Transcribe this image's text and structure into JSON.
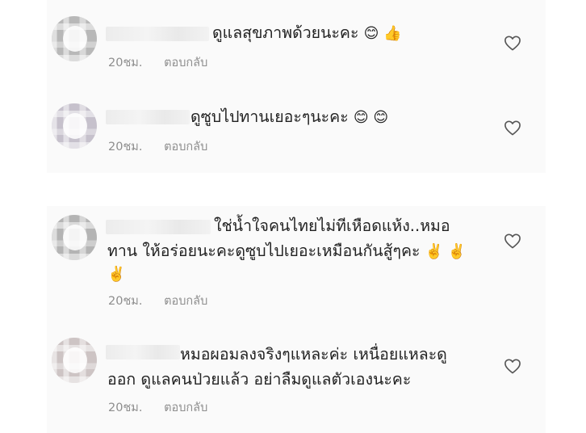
{
  "comments": [
    {
      "text_line1": "ดูแลสุขภาพด้วยนะคะ",
      "emojis": "😊 👍",
      "time": "20ชม.",
      "reply": "ตอบกลับ"
    },
    {
      "text_line1": "ดูซูบไปทานเยอะๆนะคะ",
      "emojis": "😊 😊",
      "time": "20ชม.",
      "reply": "ตอบกลับ"
    },
    {
      "text_line1": "ใช่น้ำใจคนไทยไม่ทีเหือดแห้ง..หมอ",
      "text_line2": "ทาน ให้อร่อยนะคะดูซูบไปเยอะเหมือนกันสู้ๆคะ",
      "emojis_line2": "✌️ ✌️",
      "emojis_line3": "✌️",
      "time": "20ชม.",
      "reply": "ตอบกลับ"
    },
    {
      "text_line1": "หมอผอมลงจริงๆแหละค่ะ เหนื่อยแหละดู",
      "text_line2": "ออก ดูแลคนป่วยแล้ว อย่าลืมดูแลตัวเองนะคะ",
      "time": "20ชม.",
      "reply": "ตอบกลับ"
    }
  ],
  "icons": {
    "like": "heart-outline-icon",
    "avatar": "blurred-avatar"
  },
  "colors": {
    "panel_bg": "#fafafa",
    "meta_text": "#8e8e8e",
    "heart_stroke": "#555555"
  }
}
